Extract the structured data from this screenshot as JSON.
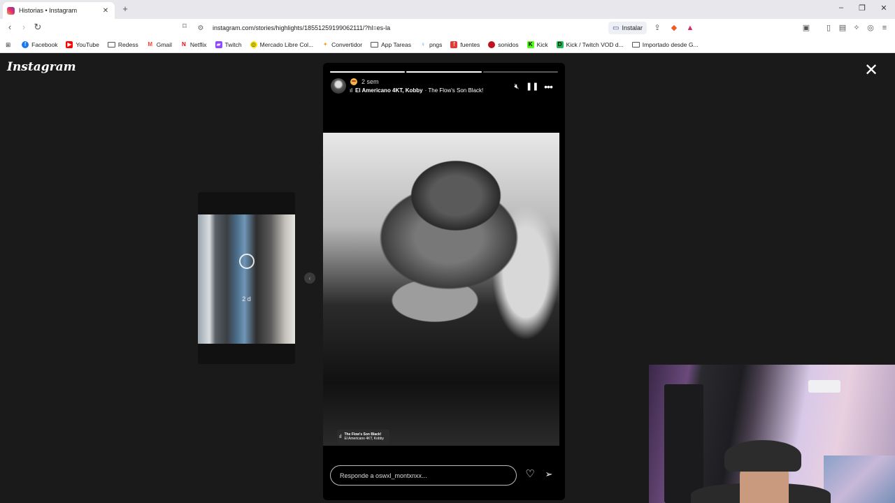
{
  "browser": {
    "tab_title": "Historias • Instagram",
    "tab_close": "✕",
    "new_tab": "+",
    "url": "instagram.com/stories/highlights/18551259199062111/?hl=es-la",
    "install_label": "Instalar",
    "window_controls": [
      "–",
      "❐",
      "✕"
    ]
  },
  "bookmarks": [
    {
      "label": "Facebook",
      "icon": "facebook-icon",
      "color": "#1877f2"
    },
    {
      "label": "YouTube",
      "icon": "youtube-icon",
      "color": "#ff0000"
    },
    {
      "label": "Redess",
      "icon": "folder-icon"
    },
    {
      "label": "Gmail",
      "icon": "gmail-icon",
      "color": "#ea4335"
    },
    {
      "label": "Netflix",
      "icon": "netflix-icon",
      "color": "#e50914"
    },
    {
      "label": "Twitch",
      "icon": "twitch-icon",
      "color": "#9146ff"
    },
    {
      "label": "Mercado Libre Col...",
      "icon": "mercadolibre-icon",
      "color": "#ffe600"
    },
    {
      "label": "Convertidor",
      "icon": "convertidor-icon",
      "color": "#f39c12"
    },
    {
      "label": "App Tareas",
      "icon": "folder-icon"
    },
    {
      "label": "pngs",
      "icon": "pngs-icon",
      "color": "#2d8cf0"
    },
    {
      "label": "fuentes",
      "icon": "fuentes-icon",
      "color": "#e53935"
    },
    {
      "label": "sonidos",
      "icon": "sonidos-icon",
      "color": "#c0121b"
    },
    {
      "label": "Kick",
      "icon": "kick-icon",
      "color": "#53fc18"
    },
    {
      "label": "Kick / Twitch VOD d...",
      "icon": "kick-vod-icon",
      "color": "#1db954"
    },
    {
      "label": "Importado desde G...",
      "icon": "folder-icon"
    }
  ],
  "page": {
    "logo": "Instagram",
    "close": "✕"
  },
  "preview": {
    "age": "2 d"
  },
  "story": {
    "progress": [
      1.0,
      1.0,
      0.0
    ],
    "time": "2 sem",
    "music_artists": "El Americano 4KT, Kobby",
    "music_title": "· The Flow's Son Black!",
    "tag_title": "The Flow's Son Black!",
    "tag_artists": "El Americano 4KT, Kobby",
    "reply_placeholder": "Responde a oswxl_montxnxx..."
  }
}
